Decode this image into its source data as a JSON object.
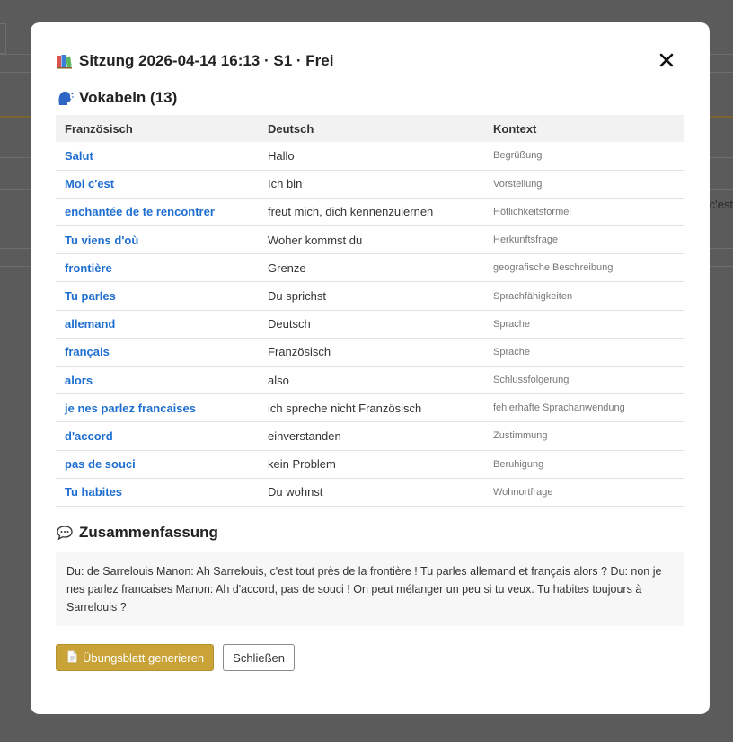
{
  "background": {
    "partial_text": "c'est"
  },
  "modal": {
    "title": "Sitzung 2026-04-14 16:13 · S1 · Frei",
    "title_icon": "books-icon",
    "close_icon": "close-icon"
  },
  "vocab": {
    "heading": "Vokabeln (13)",
    "heading_icon": "speaking-head-icon",
    "columns": [
      "Französisch",
      "Deutsch",
      "Kontext"
    ],
    "rows": [
      {
        "fr": "Salut",
        "de": "Hallo",
        "ctx": "Begrüßung"
      },
      {
        "fr": "Moi c'est",
        "de": "Ich bin",
        "ctx": "Vorstellung"
      },
      {
        "fr": "enchantée de te rencontrer",
        "de": "freut mich, dich kennenzulernen",
        "ctx": "Höflichkeitsformel"
      },
      {
        "fr": "Tu viens d'où",
        "de": "Woher kommst du",
        "ctx": "Herkunftsfrage"
      },
      {
        "fr": "frontière",
        "de": "Grenze",
        "ctx": "geografische Beschreibung"
      },
      {
        "fr": "Tu parles",
        "de": "Du sprichst",
        "ctx": "Sprachfähigkeiten"
      },
      {
        "fr": "allemand",
        "de": "Deutsch",
        "ctx": "Sprache"
      },
      {
        "fr": "français",
        "de": "Französisch",
        "ctx": "Sprache"
      },
      {
        "fr": "alors",
        "de": "also",
        "ctx": "Schlussfolgerung"
      },
      {
        "fr": "je nes parlez francaises",
        "de": "ich spreche nicht Französisch",
        "ctx": "fehlerhafte Sprachanwendung"
      },
      {
        "fr": "d'accord",
        "de": "einverstanden",
        "ctx": "Zustimmung"
      },
      {
        "fr": "pas de souci",
        "de": "kein Problem",
        "ctx": "Beruhigung"
      },
      {
        "fr": "Tu habites",
        "de": "Du wohnst",
        "ctx": "Wohnortfrage"
      }
    ]
  },
  "summary": {
    "heading": "Zusammenfassung",
    "heading_icon": "speech-bubble-icon",
    "text": "Du: de Sarrelouis Manon: Ah Sarrelouis, c'est tout près de la frontière ! Tu parles allemand et français alors ? Du: non je nes parlez francaises Manon: Ah d'accord, pas de souci ! On peut mélanger un peu si tu veux. Tu habites toujours à Sarrelouis ?"
  },
  "buttons": {
    "generate_label": "Übungsblatt generieren",
    "generate_icon": "document-icon",
    "close_label": "Schließen"
  },
  "colors": {
    "accent": "#c9a338",
    "link": "#1f6fd1"
  }
}
